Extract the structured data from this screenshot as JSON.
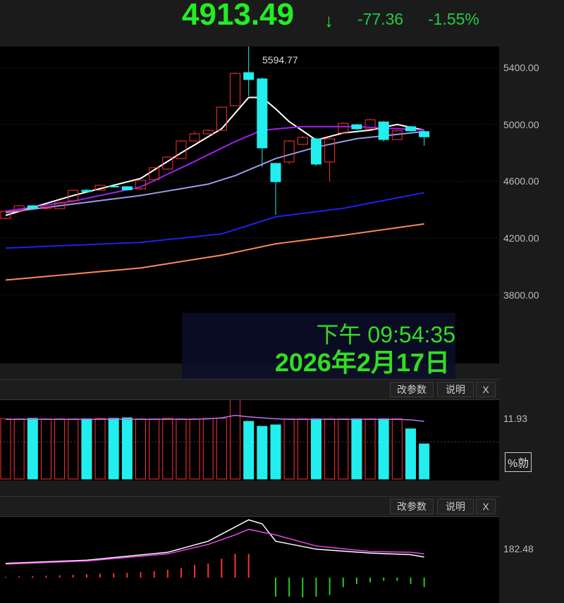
{
  "header": {
    "price": "4913.49",
    "arrow": "↓",
    "change": "-77.36",
    "change_pct": "-1.55%"
  },
  "main_chart": {
    "y_ticks": [
      "5400.00",
      "5000.00",
      "4600.00",
      "4200.00",
      "3800.00"
    ],
    "y_tick_values": [
      5400,
      5000,
      4600,
      4200,
      3800
    ],
    "high_label": "5594.77",
    "candles": [
      [
        4339,
        4389,
        4330,
        4395
      ],
      [
        4390,
        4428,
        4385,
        4432
      ],
      [
        4428,
        4410,
        4405,
        4432
      ],
      [
        4408,
        4418,
        4404,
        4420
      ],
      [
        4408,
        4448,
        4405,
        4452
      ],
      [
        4463,
        4537,
        4460,
        4540
      ],
      [
        4537,
        4527,
        4522,
        4545
      ],
      [
        4537,
        4572,
        4535,
        4575
      ],
      [
        4565,
        4560,
        4555,
        4568
      ],
      [
        4562,
        4540,
        4535,
        4566
      ],
      [
        4547,
        4607,
        4540,
        4610
      ],
      [
        4612,
        4696,
        4610,
        4700
      ],
      [
        4686,
        4770,
        4680,
        4775
      ],
      [
        4760,
        4884,
        4755,
        4890
      ],
      [
        4884,
        4934,
        4880,
        4950
      ],
      [
        4934,
        4959,
        4930,
        4965
      ],
      [
        4959,
        5122,
        4955,
        5125
      ],
      [
        5132,
        5360,
        5130,
        5365
      ],
      [
        5365,
        5316,
        5200,
        5595
      ],
      [
        5321,
        4835,
        4700,
        5330
      ],
      [
        4726,
        4597,
        4364,
        4730
      ],
      [
        4736,
        4884,
        4720,
        4890
      ],
      [
        4860,
        4909,
        4855,
        4920
      ],
      [
        4899,
        4721,
        4710,
        4905
      ],
      [
        4736,
        4899,
        4597,
        4905
      ],
      [
        4940,
        5008,
        4935,
        5015
      ],
      [
        4998,
        4969,
        4960,
        5005
      ],
      [
        4969,
        5033,
        4965,
        5040
      ],
      [
        5018,
        4894,
        4880,
        5025
      ],
      [
        4894,
        4955,
        4890,
        4960
      ],
      [
        4984,
        4955,
        4950,
        4990
      ],
      [
        4950,
        4913,
        4850,
        4955
      ]
    ],
    "ma": [
      {
        "color": "#ffffff",
        "points": [
          [
            0,
            4360
          ],
          [
            5,
            4500
          ],
          [
            10,
            4620
          ],
          [
            13,
            4800
          ],
          [
            16,
            4970
          ],
          [
            18,
            5190
          ],
          [
            19,
            5190
          ],
          [
            20,
            5110
          ],
          [
            21,
            5020
          ],
          [
            23,
            4890
          ],
          [
            25,
            4940
          ],
          [
            27,
            4960
          ],
          [
            29,
            5000
          ],
          [
            31,
            4960
          ]
        ]
      },
      {
        "color": "#a020f0",
        "points": [
          [
            0,
            4390
          ],
          [
            5,
            4460
          ],
          [
            10,
            4560
          ],
          [
            14,
            4740
          ],
          [
            17,
            4880
          ],
          [
            19,
            4960
          ],
          [
            22,
            4985
          ],
          [
            26,
            4985
          ],
          [
            31,
            4960
          ]
        ]
      },
      {
        "color": "#9a9ae6",
        "points": [
          [
            0,
            4380
          ],
          [
            5,
            4440
          ],
          [
            10,
            4500
          ],
          [
            15,
            4580
          ],
          [
            17,
            4640
          ],
          [
            20,
            4760
          ],
          [
            23,
            4840
          ],
          [
            26,
            4900
          ],
          [
            31,
            4950
          ]
        ]
      },
      {
        "color": "#2020ee",
        "points": [
          [
            0,
            4130
          ],
          [
            10,
            4170
          ],
          [
            16,
            4230
          ],
          [
            20,
            4350
          ],
          [
            25,
            4410
          ],
          [
            31,
            4520
          ]
        ]
      },
      {
        "color": "#ff8855",
        "points": [
          [
            0,
            3905
          ],
          [
            10,
            3990
          ],
          [
            16,
            4080
          ],
          [
            20,
            4160
          ],
          [
            25,
            4220
          ],
          [
            31,
            4300
          ]
        ]
      }
    ]
  },
  "overlay": {
    "time": "下午 09:54:35",
    "date": "2026年2月17日"
  },
  "volume_pane": {
    "buttons": [
      "改参数",
      "说明",
      "X"
    ],
    "label": "11.93",
    "unit_button": "%勍",
    "values": [
      12,
      12,
      12.1,
      12,
      12,
      12,
      12,
      12.1,
      12.1,
      12.2,
      12,
      12,
      12.1,
      12,
      12,
      12.1,
      12.1,
      15.8,
      11.5,
      10.5,
      10.8,
      12,
      12,
      12,
      12,
      12,
      12,
      12,
      12,
      12,
      10,
      7
    ],
    "ma": [
      11.9,
      11.9,
      11.9,
      11.9,
      11.9,
      11.9,
      11.9,
      11.9,
      11.9,
      11.9,
      11.9,
      11.9,
      11.9,
      11.9,
      11.9,
      12.0,
      12.2,
      12.7,
      12.4,
      12.2,
      12.0,
      11.9,
      11.9,
      11.9,
      11.9,
      11.9,
      11.9,
      11.9,
      11.9,
      11.9,
      11.8,
      11.5
    ]
  },
  "macd_pane": {
    "buttons": [
      "改参数",
      "说明",
      "X"
    ],
    "label": "182.48",
    "line1": [
      [
        0,
        90
      ],
      [
        6,
        110
      ],
      [
        12,
        160
      ],
      [
        15,
        230
      ],
      [
        17,
        320
      ],
      [
        18,
        365
      ],
      [
        19,
        340
      ],
      [
        20,
        230
      ],
      [
        23,
        180
      ],
      [
        27,
        155
      ],
      [
        30,
        145
      ],
      [
        31,
        130
      ]
    ],
    "line2": [
      [
        0,
        85
      ],
      [
        6,
        105
      ],
      [
        12,
        150
      ],
      [
        15,
        210
      ],
      [
        17,
        270
      ],
      [
        18,
        305
      ],
      [
        20,
        270
      ],
      [
        23,
        200
      ],
      [
        27,
        165
      ],
      [
        30,
        160
      ],
      [
        31,
        150
      ]
    ],
    "hist": [
      5,
      8,
      10,
      12,
      15,
      18,
      22,
      25,
      28,
      30,
      35,
      40,
      50,
      60,
      80,
      90,
      120,
      150,
      150,
      0,
      -120,
      -120,
      -125,
      -120,
      -110,
      -60,
      -40,
      -30,
      -20,
      -20,
      -40,
      -60
    ]
  }
}
